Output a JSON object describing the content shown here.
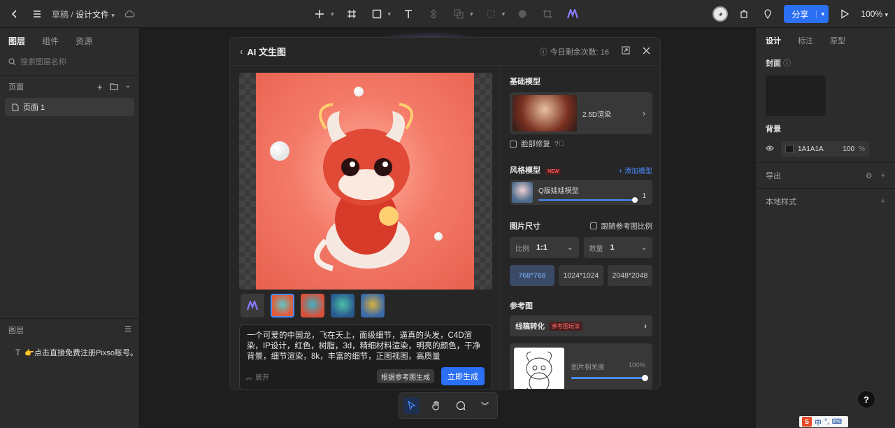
{
  "topbar": {
    "breadcrumb_root": "草稿",
    "breadcrumb_sep": "/",
    "file_name": "设计文件",
    "share_label": "分享",
    "zoom": "100%"
  },
  "left_panel": {
    "tabs": [
      "图层",
      "组件",
      "资源"
    ],
    "search_placeholder": "搜索图层名称",
    "pages_label": "页面",
    "page_item": "页面 1",
    "layers_label": "图层",
    "layer_item": "👉点击直接免费注册Pixso账号。"
  },
  "right_panel": {
    "tabs": [
      "设计",
      "标注",
      "原型"
    ],
    "cover_label": "封面",
    "background_label": "背景",
    "bg_hex": "1A1A1A",
    "bg_opacity": "100",
    "bg_unit": "%",
    "export_label": "导出",
    "local_styles_label": "本地样式"
  },
  "modal": {
    "title": "AI 文生图",
    "quota": "今日剩余次数: 16",
    "prompt": "一个可爱的中国龙，飞在天上，面级细节，逼真的头发，C4D渲染，IP设计，红色，树脂，3d，精细材料渲染，明亮的颜色，干净背景，细节渲染，8k，丰富的细节，正图视图，高质量",
    "expand_label": "展开",
    "ref_gen_label": "根据参考图生成",
    "generate_label": "立即生成",
    "base_model_label": "基础模型",
    "base_model_name": "2.5D渲染",
    "face_fix_label": "脸部修复",
    "style_model_label": "风格模型",
    "new_badge": "NEW",
    "add_model_label": "+ 添加模型",
    "style_model_name": "Q版娃娃模型",
    "style_model_weight": "1",
    "image_size_label": "图片尺寸",
    "follow_ref_label": "跟随参考图比例",
    "ratio_label": "比例",
    "ratio_value": "1:1",
    "count_label": "数量",
    "count_value": "1",
    "sizes": [
      "768*768",
      "1024*1024",
      "2048*2048"
    ],
    "reference_label": "参考图",
    "line_convert_label": "线稿转化",
    "ref_play_badge": "参考图玩法",
    "relevance_label": "图片相关度",
    "relevance_value": "100%"
  },
  "colors": {
    "accent": "#2b6ff3",
    "panel": "#2c2c2c",
    "canvas": "#1e1e1e"
  }
}
